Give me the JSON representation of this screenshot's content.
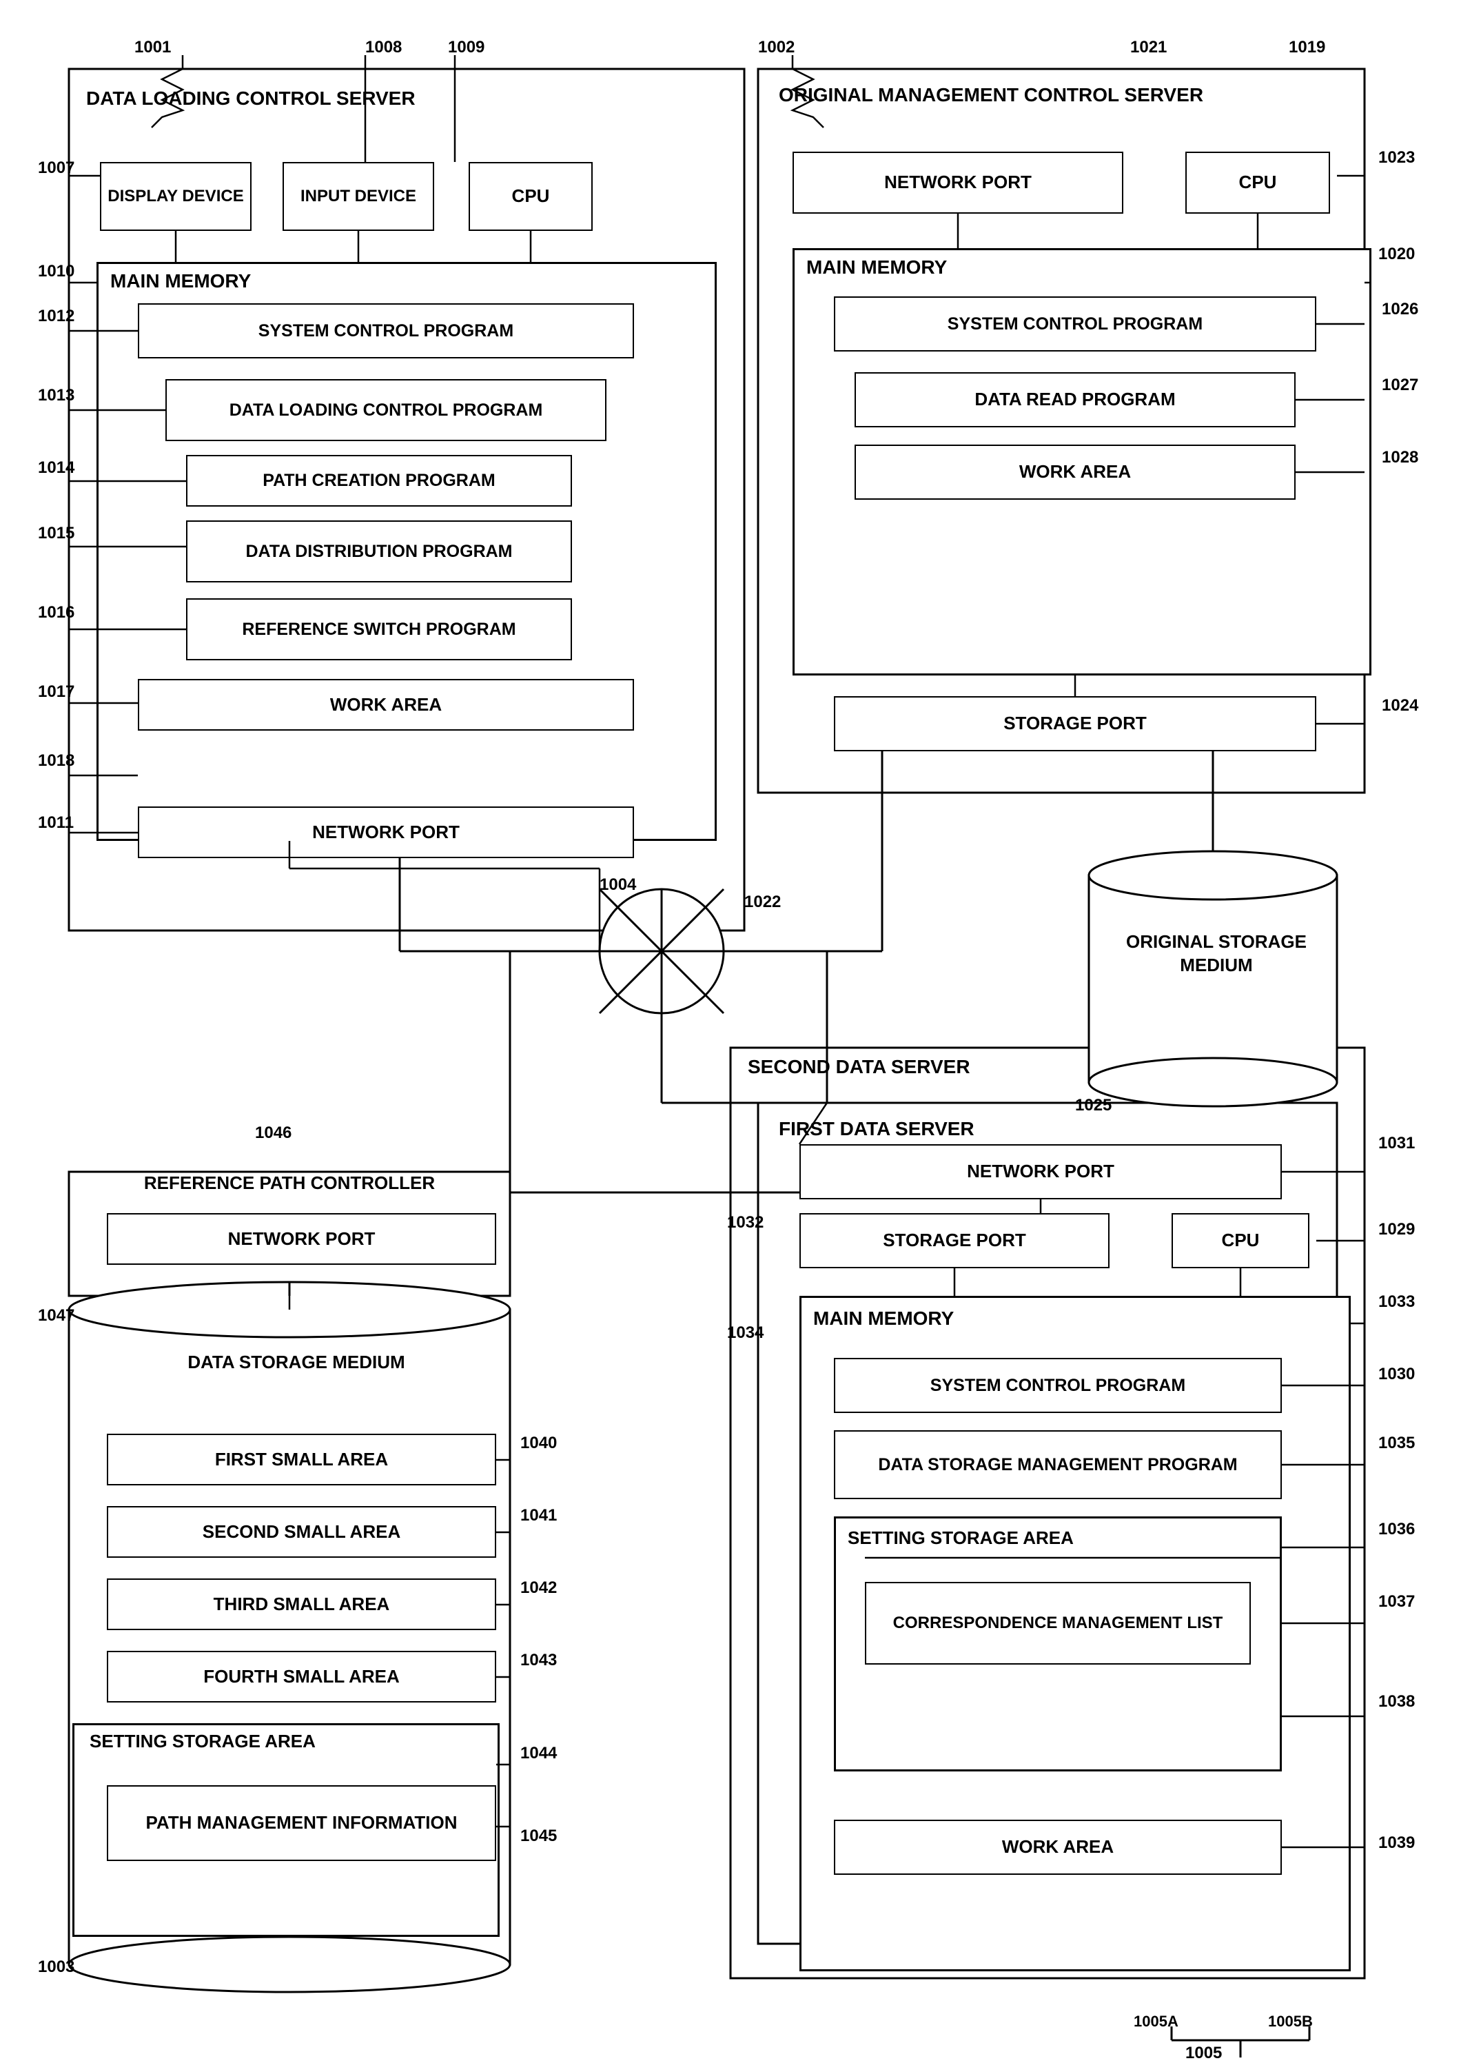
{
  "labels": {
    "ref_num_1001": "1001",
    "ref_num_1002": "1002",
    "ref_num_1003": "1003",
    "ref_num_1004": "1004",
    "ref_num_1005": "1005",
    "ref_num_1005A": "1005A",
    "ref_num_1005B": "1005B",
    "ref_num_1007": "1007",
    "ref_num_1008": "1008",
    "ref_num_1009": "1009",
    "ref_num_1010": "1010",
    "ref_num_1011": "1011",
    "ref_num_1012": "1012",
    "ref_num_1013": "1013",
    "ref_num_1014": "1014",
    "ref_num_1015": "1015",
    "ref_num_1016": "1016",
    "ref_num_1017": "1017",
    "ref_num_1018": "1018",
    "ref_num_1019": "1019",
    "ref_num_1020": "1020",
    "ref_num_1021": "1021",
    "ref_num_1022": "1022",
    "ref_num_1023": "1023",
    "ref_num_1024": "1024",
    "ref_num_1025": "1025",
    "ref_num_1026": "1026",
    "ref_num_1027": "1027",
    "ref_num_1028": "1028",
    "ref_num_1029": "1029",
    "ref_num_1030": "1030",
    "ref_num_1031": "1031",
    "ref_num_1032": "1032",
    "ref_num_1033": "1033",
    "ref_num_1034": "1034",
    "ref_num_1035": "1035",
    "ref_num_1036": "1036",
    "ref_num_1037": "1037",
    "ref_num_1038": "1038",
    "ref_num_1039": "1039",
    "ref_num_1040": "1040",
    "ref_num_1041": "1041",
    "ref_num_1042": "1042",
    "ref_num_1043": "1043",
    "ref_num_1044": "1044",
    "ref_num_1045": "1045",
    "ref_num_1046": "1046",
    "ref_num_1047": "1047",
    "server1_title": "DATA LOADING CONTROL SERVER",
    "server2_title": "ORIGINAL MANAGEMENT CONTROL SERVER",
    "server3_title": "SECOND DATA SERVER",
    "server3a_title": "FIRST DATA SERVER",
    "display_device": "DISPLAY DEVICE",
    "input_device": "INPUT DEVICE",
    "cpu": "CPU",
    "network_port": "NETWORK PORT",
    "storage_port": "STORAGE PORT",
    "main_memory": "MAIN MEMORY",
    "system_control_program": "SYSTEM CONTROL PROGRAM",
    "data_loading_control_program": "DATA LOADING CONTROL PROGRAM",
    "path_creation_program": "PATH CREATION PROGRAM",
    "data_distribution_program": "DATA DISTRIBUTION PROGRAM",
    "reference_switch_program": "REFERENCE SWITCH PROGRAM",
    "work_area": "WORK AREA",
    "data_read_program": "DATA READ PROGRAM",
    "original_storage_medium": "ORIGINAL STORAGE MEDIUM",
    "reference_path_controller": "REFERENCE PATH CONTROLLER",
    "data_storage_medium": "DATA STORAGE MEDIUM",
    "first_small_area": "FIRST SMALL AREA",
    "second_small_area": "SECOND SMALL AREA",
    "third_small_area": "THIRD SMALL AREA",
    "fourth_small_area": "FOURTH SMALL AREA",
    "setting_storage_area": "SETTING STORAGE AREA",
    "path_management_information": "PATH MANAGEMENT INFORMATION",
    "system_control_program2": "SYSTEM CONTROL PROGRAM",
    "data_storage_management_program": "DATA STORAGE MANAGEMENT PROGRAM",
    "setting_storage_area2": "SETTING STORAGE AREA",
    "correspondence_management_list": "CORRESPONDENCE MANAGEMENT LIST",
    "work_area2": "WORK AREA"
  }
}
